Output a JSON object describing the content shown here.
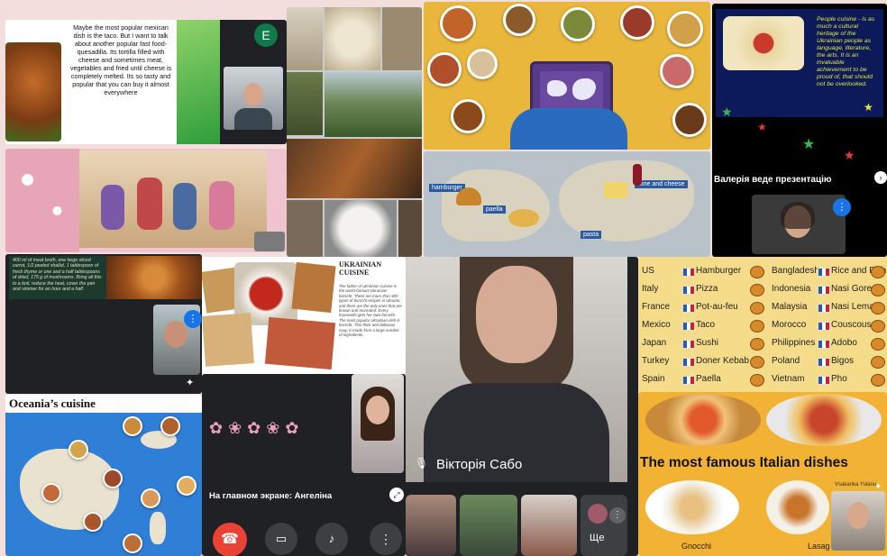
{
  "tiles": {
    "taco": {
      "text": "Maybe the most popular mexican dish is the taco. But I want to talk about another popular fast food-quesadilla. Its tortilla filled with cheese and sometimes meat, vegetables and fried until cheese is completely melted. Its so tasty and popular that you can buy it almost everywhere",
      "avatar_letter": "E",
      "accent": "#3cb043"
    },
    "presenter_tile": {
      "caption": "Валерія веде презентацію",
      "slide_text": "People cuisine - is as much a cultural heritage of the Ukrainian people as language, literature, the arts. It is an invaluable achievement to be proud of, that should not be overlooked."
    },
    "recipe": {
      "text": "400 ml of meat broth, one large sliced carrot, 1/2 peeled shallot, 1 tablespoon of fresh thyme or one and a half tablespoons of dried, 175 g of mushrooms. Bring all this to a boil, reduce the heat, cover the pan and simmer for an hour and a half."
    },
    "ukrainian": {
      "title": "UKRAINIAN CUISINE",
      "text": "The father of Ukrainian cuisine is the world-famous Ukrainian borscht. There are more than 300 types of borscht recipes in Ukraine, and there are the only ones that are known and recreated. Every housewife gets her own borscht. The most popular Ukrainian dish is borscht. This thick and delicious soup is made from a large number of ingredients."
    },
    "main_screen": {
      "caption": "На главном экране: Ангеліна"
    },
    "oceania": {
      "title": "Oceania’s cuisine"
    },
    "speaker": {
      "name": "Вікторія Сабо",
      "more_label": "Ще"
    },
    "italian": {
      "title": "The most famous Italian dishes",
      "dish1": "Gnocchi",
      "dish2": "Lasag",
      "watermark": "Vsakanka Yulanu"
    },
    "map_labels": {
      "hamburger": "hamburger",
      "paella": "paella",
      "wine_cheese": "wine and cheese",
      "pasta": "pasta"
    },
    "countries": {
      "left": [
        {
          "country": "US",
          "dish": "Hamburger"
        },
        {
          "country": "Italy",
          "dish": "Pizza"
        },
        {
          "country": "France",
          "dish": "Pot-au-feu"
        },
        {
          "country": "Mexico",
          "dish": "Taco"
        },
        {
          "country": "Japan",
          "dish": "Sushi"
        },
        {
          "country": "Turkey",
          "dish": "Doner Kebab"
        },
        {
          "country": "Spain",
          "dish": "Paella"
        }
      ],
      "right": [
        {
          "country": "Bangladesh",
          "dish": "Rice and Fish"
        },
        {
          "country": "Indonesia",
          "dish": "Nasi Goreng"
        },
        {
          "country": "Malaysia",
          "dish": "Nasi Lemak"
        },
        {
          "country": "Morocco",
          "dish": "Couscous"
        },
        {
          "country": "Philippines",
          "dish": "Adobo"
        },
        {
          "country": "Poland",
          "dish": "Bigos"
        },
        {
          "country": "Vietnam",
          "dish": "Pho"
        }
      ]
    }
  },
  "colors": {
    "meet_dark": "#202124",
    "hangup_red": "#ea4335",
    "google_blue": "#1a73e8",
    "italian_yellow": "#f2b233"
  }
}
